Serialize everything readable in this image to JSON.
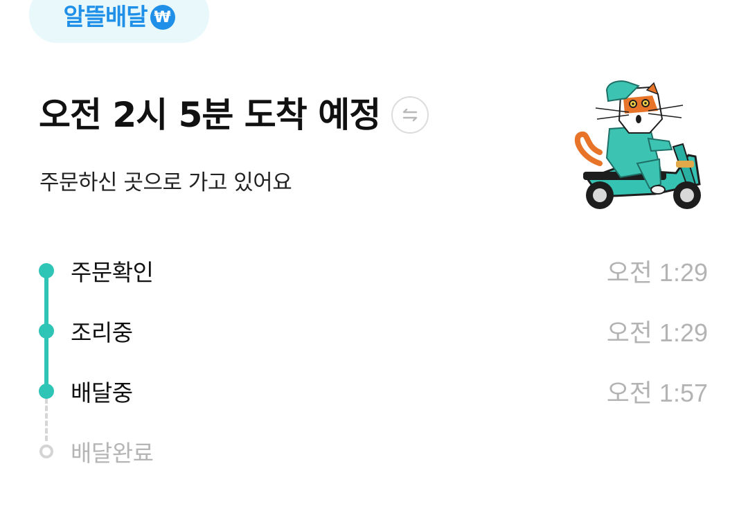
{
  "badge": {
    "text": "알뜰배달",
    "icon_glyph": "₩",
    "icon_name": "won-icon",
    "color": "#1f8fe8",
    "background": "#e9f8fb"
  },
  "header": {
    "title": "오전 2시 5분 도착 예정",
    "swap_icon": "swap-arrows-icon",
    "subtitle": "주문하신 곳으로 가고 있어요"
  },
  "illustration": {
    "icon": "cat-rider-scooter-illustration"
  },
  "timeline": {
    "accent_color": "#2ec4b6",
    "steps": [
      {
        "label": "주문확인",
        "time": "오전 1:29",
        "status": "done"
      },
      {
        "label": "조리중",
        "time": "오전 1:29",
        "status": "done"
      },
      {
        "label": "배달중",
        "time": "오전 1:57",
        "status": "current"
      },
      {
        "label": "배달완료",
        "time": "",
        "status": "pending"
      }
    ]
  }
}
